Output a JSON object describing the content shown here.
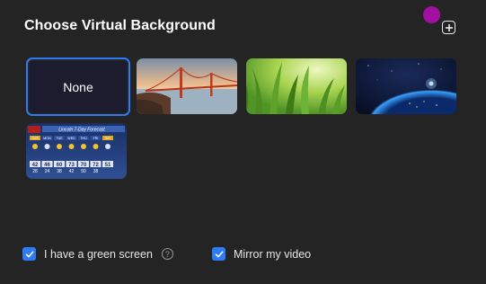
{
  "dialog": {
    "title": "Choose Virtual Background",
    "add_icon": "plus-square-icon"
  },
  "backgrounds": [
    {
      "label": "None",
      "selected": true
    },
    {
      "label": "",
      "image": "golden-gate-bridge",
      "selected": false
    },
    {
      "label": "",
      "image": "green-grass",
      "selected": false
    },
    {
      "label": "",
      "image": "earth-from-space",
      "selected": false
    },
    {
      "label": "",
      "image": "weather-forecast",
      "selected": false
    }
  ],
  "weather_tile": {
    "header": "Lincoln 7-Day Forecast",
    "days": [
      "SUN",
      "MON",
      "TUE",
      "WED",
      "THU",
      "FRI",
      "SAT"
    ],
    "highs": [
      "42",
      "46",
      "60",
      "73",
      "70",
      "72",
      "51"
    ],
    "lows": [
      "28",
      "24",
      "38",
      "42",
      "50",
      "38"
    ]
  },
  "options": {
    "green_screen_label": "I have a green screen",
    "green_screen_checked": true,
    "mirror_label": "Mirror my video",
    "mirror_checked": true
  },
  "colors": {
    "background": "#242424",
    "accent": "#2f7bf5",
    "cursor": "#a1109f"
  }
}
